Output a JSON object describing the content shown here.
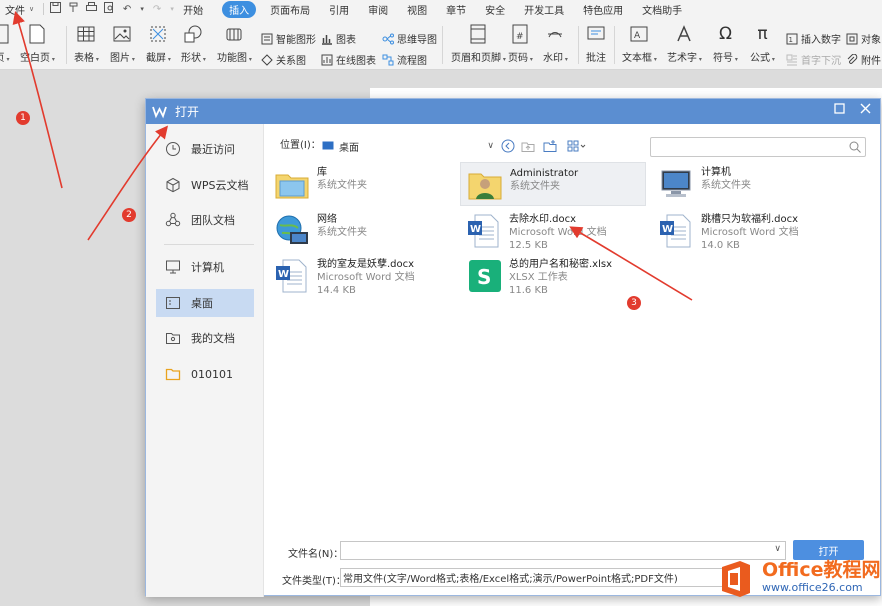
{
  "menubar": {
    "file_label": "文件",
    "tabs": [
      {
        "label": "开始",
        "active": false
      },
      {
        "label": "插入",
        "active": true
      },
      {
        "label": "页面布局",
        "active": false
      },
      {
        "label": "引用",
        "active": false
      },
      {
        "label": "审阅",
        "active": false
      },
      {
        "label": "视图",
        "active": false
      },
      {
        "label": "章节",
        "active": false
      },
      {
        "label": "安全",
        "active": false
      },
      {
        "label": "开发工具",
        "active": false
      },
      {
        "label": "特色应用",
        "active": false
      },
      {
        "label": "文档助手",
        "active": false
      }
    ]
  },
  "ribbon": {
    "page_cut": "页",
    "blank_page": "空白页",
    "table": "表格",
    "picture": "图片",
    "screenshot": "截屏",
    "shape": "形状",
    "function_chart": "功能图",
    "smart_shape": "智能图形",
    "chart": "图表",
    "mind_map": "思维导图",
    "relation_map": "关系图",
    "online_chart": "在线图表",
    "flowchart": "流程图",
    "header_footer": "页眉和页脚",
    "page_number": "页码",
    "watermark": "水印",
    "comment": "批注",
    "textbox": "文本框",
    "wordart": "艺术字",
    "symbol": "符号",
    "formula": "公式",
    "insert_number": "插入数字",
    "drop_cap": "首字下沉",
    "object": "对象",
    "attachment": "附件"
  },
  "dialog": {
    "title": "打开",
    "sidebar": [
      {
        "label": "最近访问",
        "icon": "clock-icon",
        "active": false
      },
      {
        "label": "WPS云文档",
        "icon": "cube-icon",
        "active": false
      },
      {
        "label": "团队文档",
        "icon": "team-icon",
        "active": false
      },
      {
        "label": "计算机",
        "icon": "monitor-icon",
        "active": false
      },
      {
        "label": "桌面",
        "icon": "desktop-icon",
        "active": true
      },
      {
        "label": "我的文档",
        "icon": "my-docs-icon",
        "active": false
      },
      {
        "label": "010101",
        "icon": "folder-icon",
        "active": false
      }
    ],
    "location_label": "位置(I)：",
    "location_value": "桌面",
    "files": [
      {
        "name": "库",
        "type": "系统文件夹",
        "size": "",
        "icon": "library-folder-icon"
      },
      {
        "name": "Administrator",
        "type": "系统文件夹",
        "size": "",
        "icon": "user-folder-icon"
      },
      {
        "name": "计算机",
        "type": "系统文件夹",
        "size": "",
        "icon": "computer-icon"
      },
      {
        "name": "网络",
        "type": "系统文件夹",
        "size": "",
        "icon": "network-icon"
      },
      {
        "name": "去除水印.docx",
        "type": "Microsoft Word 文档",
        "size": "12.5 KB",
        "icon": "word-doc-icon"
      },
      {
        "name": "跳槽只为软福利.docx",
        "type": "Microsoft Word 文档",
        "size": "14.0 KB",
        "icon": "word-doc-icon"
      },
      {
        "name": "我的室友是妖孽.docx",
        "type": "Microsoft Word 文档",
        "size": "14.4 KB",
        "icon": "word-doc-icon"
      },
      {
        "name": "总的用户名和秘密.xlsx",
        "type": "XLSX 工作表",
        "size": "11.6 KB",
        "icon": "xlsx-icon"
      }
    ],
    "filename_label": "文件名(N)：",
    "filename_value": "",
    "open_button": "打开",
    "filetype_label": "文件类型(T)：",
    "filetype_value": "常用文件(文字/Word格式;表格/Excel格式;演示/PowerPoint格式;PDF文件)"
  },
  "annotations": {
    "badge1": "1",
    "badge2": "2",
    "badge3": "3",
    "arrow_color": "#e23b2e"
  },
  "watermark": {
    "line1": "Office教程网",
    "line2": "www.office26.com"
  },
  "colors": {
    "accent": "#3d8fe0",
    "title_bar": "#5b8ed1",
    "selected": "#c8daf2"
  }
}
